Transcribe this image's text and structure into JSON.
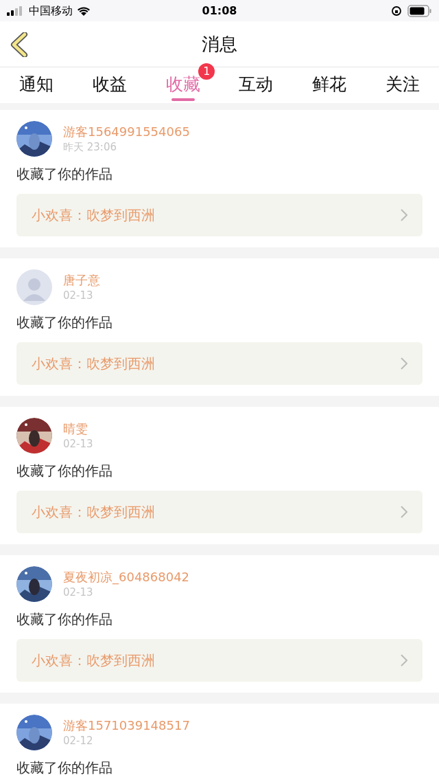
{
  "status_bar": {
    "carrier": "中国移动",
    "time": "01:08"
  },
  "header": {
    "title": "消息"
  },
  "tabs": [
    {
      "label": "通知",
      "selected": false
    },
    {
      "label": "收益",
      "selected": false
    },
    {
      "label": "收藏",
      "selected": true,
      "badge": "1"
    },
    {
      "label": "互动",
      "selected": false
    },
    {
      "label": "鲜花",
      "selected": false
    },
    {
      "label": "关注",
      "selected": false
    }
  ],
  "messages": [
    {
      "name": "游客1564991554065",
      "time": "昨天 23:06",
      "action": "收藏了你的作品",
      "work": "小欢喜：吹梦到西洲"
    },
    {
      "avatar": {
        "kind": "default"
      },
      "name": "唐子意",
      "time": "02-13",
      "action": "收藏了你的作品",
      "work": "小欢喜：吹梦到西洲"
    },
    {
      "name": "晴雯",
      "time": "02-13",
      "action": "收藏了你的作品",
      "work": "小欢喜：吹梦到西洲"
    },
    {
      "name": "夏夜初凉_604868042",
      "time": "02-13",
      "action": "收藏了你的作品",
      "work": "小欢喜：吹梦到西洲"
    },
    {
      "name": "游客1571039148517",
      "time": "02-12",
      "action": "收藏了你的作品"
    }
  ]
}
